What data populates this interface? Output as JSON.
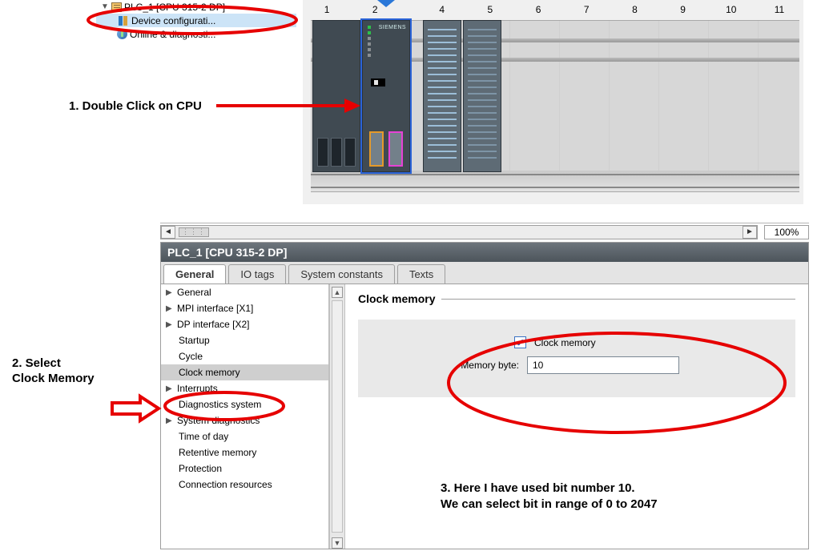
{
  "tree": {
    "plc": "PLC_1 [CPU 315-2 DP]",
    "devcfg": "Device configurati...",
    "diag": "Online & diagnosti..."
  },
  "rack": {
    "slots": [
      "1",
      "2",
      "4",
      "5",
      "6",
      "7",
      "8",
      "9",
      "10",
      "11"
    ],
    "cpu_brand": "SIEMENS"
  },
  "scroll": {
    "zoom": "100%"
  },
  "props": {
    "title": "PLC_1 [CPU 315-2 DP]",
    "tabs": {
      "general": "General",
      "io": "IO tags",
      "sys": "System constants",
      "texts": "Texts"
    },
    "nav": {
      "general": "General",
      "mpi": "MPI interface [X1]",
      "dp": "DP interface [X2]",
      "startup": "Startup",
      "cycle": "Cycle",
      "clock": "Clock memory",
      "intr": "Interrupts",
      "diagsys": "Diagnostics system",
      "sysdiag": "System diagnostics",
      "tod": "Time of day",
      "ret": "Retentive memory",
      "prot": "Protection",
      "conn": "Connection resources"
    },
    "section_title": "Clock memory",
    "chk_label": "Clock memory",
    "chk_checked": true,
    "membyte_label": "Memory byte:",
    "membyte_value": "10"
  },
  "anno": {
    "step1": "1. Double Click on CPU",
    "step2": "2. Select\nClock Memory",
    "step3": "3. Here I have used bit number 10.\nWe can select bit in range of 0 to 2047"
  }
}
